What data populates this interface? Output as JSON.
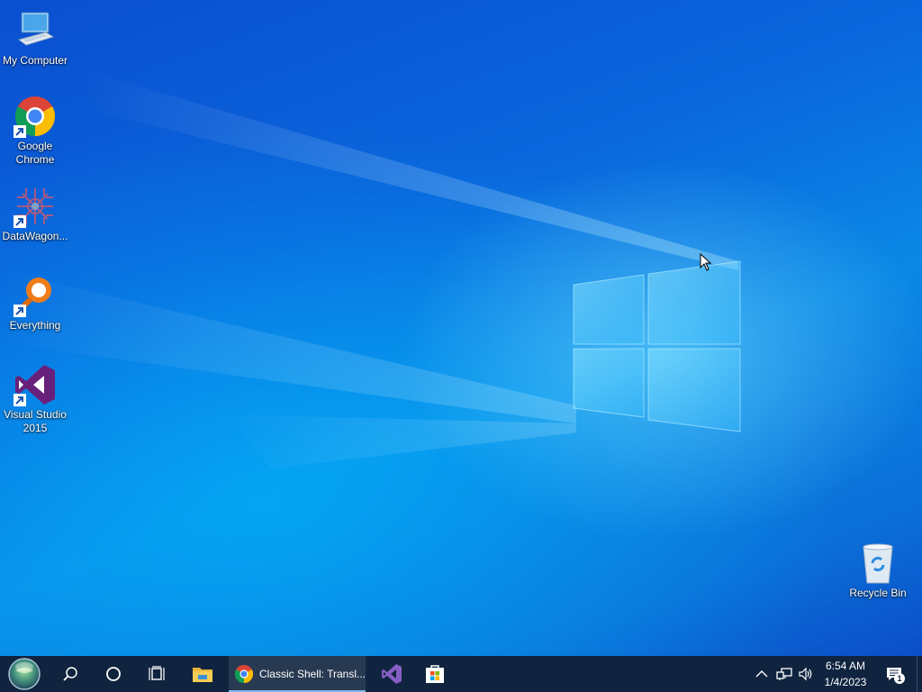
{
  "desktop": {
    "icons": [
      {
        "label": "My Computer",
        "icon": "computer-icon",
        "shortcut": false
      },
      {
        "label": "Google Chrome",
        "icon": "chrome-icon",
        "shortcut": true
      },
      {
        "label": "DataWagon...",
        "icon": "datawagon-icon",
        "shortcut": true
      },
      {
        "label": "Everything",
        "icon": "everything-search-icon",
        "shortcut": true
      },
      {
        "label": "Visual Studio 2015",
        "icon": "visual-studio-icon",
        "shortcut": true
      },
      {
        "label": "Recycle Bin",
        "icon": "recycle-bin-icon",
        "shortcut": false
      }
    ],
    "wallpaper_colors": {
      "deep": "#0a4fd0",
      "mid": "#0a88e6",
      "glow": "#78dcff"
    }
  },
  "taskbar": {
    "background": "#10243f",
    "start_icon": "start-orb-icon",
    "search_icon": "search-icon",
    "cortana_icon": "cortana-circle-icon",
    "task_view_icon": "task-view-icon",
    "pinned": [
      {
        "name": "file-explorer",
        "icon": "folder-icon"
      },
      {
        "name": "chrome",
        "icon": "chrome-icon",
        "label": "Classic Shell: Transl...",
        "active": true
      },
      {
        "name": "visual-studio",
        "icon": "visual-studio-icon"
      },
      {
        "name": "microsoft-store",
        "icon": "store-icon"
      }
    ],
    "tray": {
      "time": "6:54 AM",
      "date": "1/4/2023",
      "notification_count": "1",
      "icons": [
        "chevron-up-icon",
        "network-icon",
        "volume-icon",
        "action-center-icon"
      ]
    }
  }
}
